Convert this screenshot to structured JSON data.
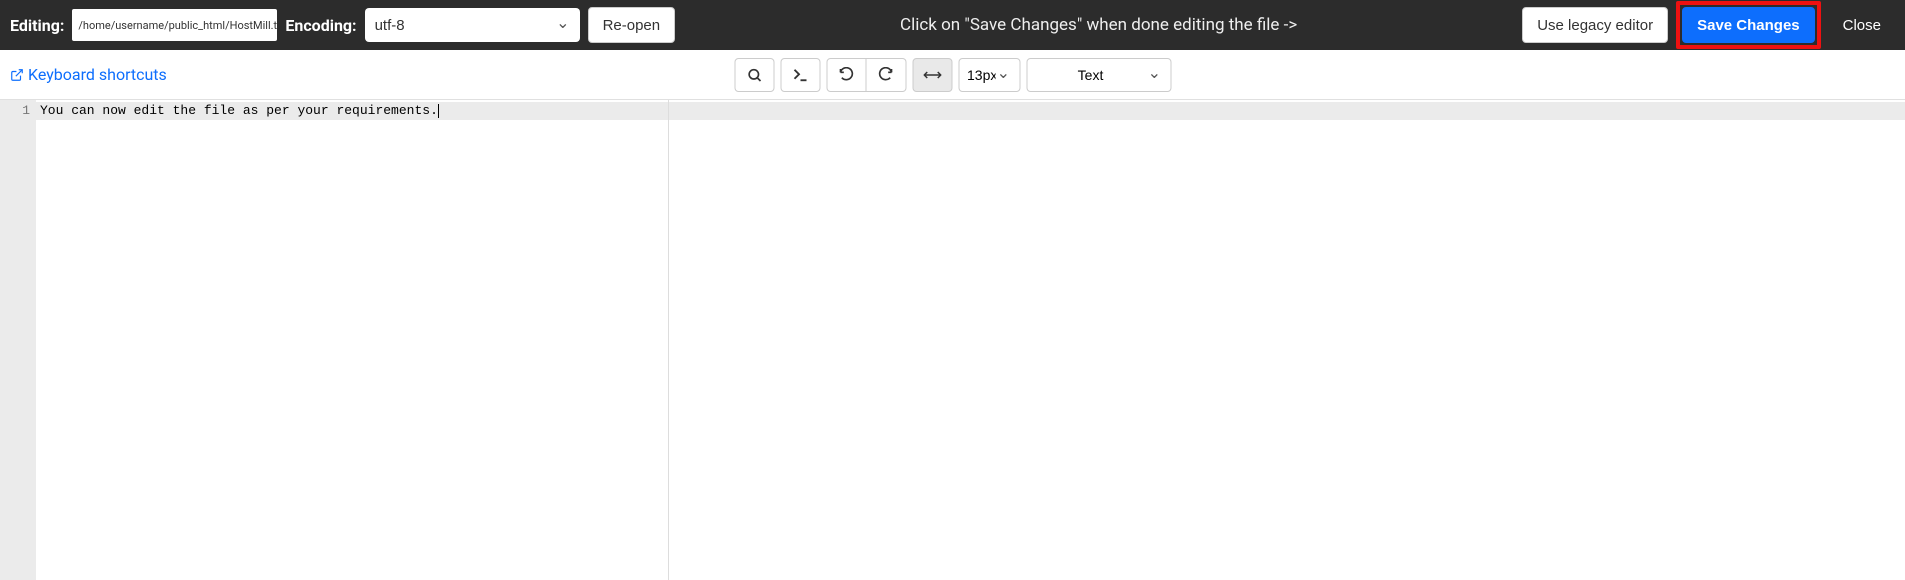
{
  "topbar": {
    "editing_label": "Editing:",
    "file_path": "/home/username/public_html/HostMill.txt",
    "encoding_label": "Encoding:",
    "encoding_value": "utf-8",
    "reopen_label": "Re-open",
    "hint": "Click on \"Save Changes\" when done editing the file ->",
    "legacy_label": "Use legacy editor",
    "save_label": "Save Changes",
    "close_label": "Close"
  },
  "toolbar": {
    "keyboard_shortcuts_label": "Keyboard shortcuts",
    "font_size_value": "13px",
    "syntax_mode_value": "Text"
  },
  "editor": {
    "line_numbers": [
      "1"
    ],
    "lines": [
      "You can now edit the file as per your requirements."
    ]
  }
}
